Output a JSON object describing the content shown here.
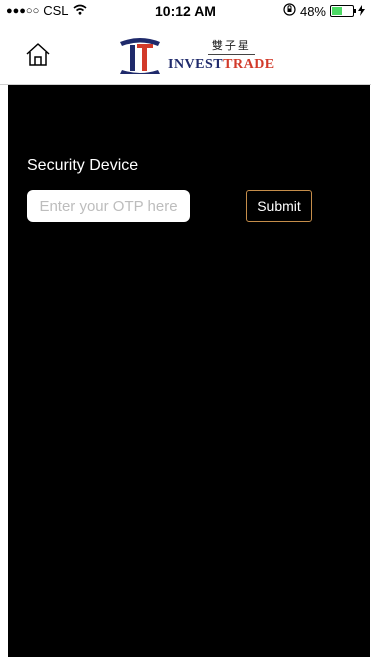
{
  "status_bar": {
    "carrier": "CSL",
    "signal_dots": "●●●○○",
    "time": "10:12 AM",
    "battery": "48%",
    "battery_level": 0.48
  },
  "header": {
    "logo_cn": "雙子星",
    "logo_en_part1": "INVEST",
    "logo_en_part2": "TRADE"
  },
  "main": {
    "section_label": "Security Device",
    "otp_placeholder": "Enter your OTP here",
    "submit_label": "Submit"
  },
  "colors": {
    "background_dark": "#000000",
    "submit_border": "#c58d4a",
    "brand_navy": "#1f2a6b",
    "brand_red": "#d23a2a",
    "battery_green": "#4cd964"
  }
}
